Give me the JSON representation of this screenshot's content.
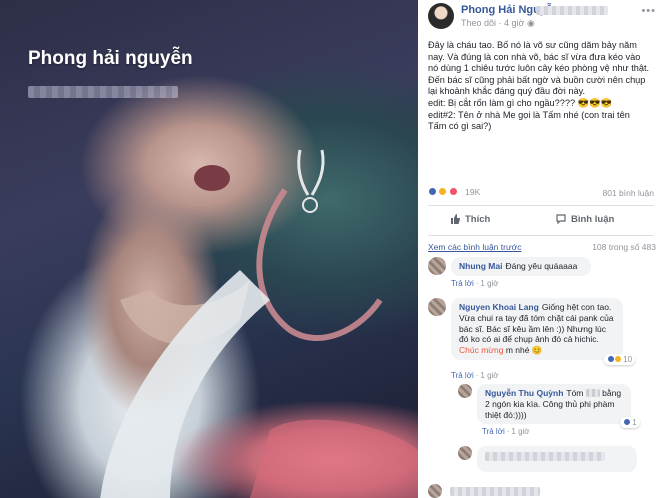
{
  "photo": {
    "watermark_name": "Phong hải nguyễn"
  },
  "post": {
    "author": "Phong Hải Nguyễn",
    "follow_label": "Theo dõi",
    "time": "4 giờ",
    "more_icon": "more-dots-icon",
    "text_lines": [
      "Đây là cháu tao. Bố nó là võ sư cũng dăm bảy năm nay. Và đúng là con nhà võ, bác sĩ vừa đưa kéo vào nó dùng 1 chiêu tước luôn cây kéo phòng vệ như thật. Đến bác sĩ cũng phải bất ngờ và buồn cười nên chụp lại khoảnh khắc đáng quý đầu đời này.",
      "edit: Bị cắt rốn làm gì cho ngầu???? 😎😎😎",
      "edit#2: Tên ở nhà Me gọi là Tấm nhé (con trai tên Tấm có gì sai?)"
    ],
    "reactions_count": "19K",
    "comments_count": "801 bình luận",
    "like_label": "Thích",
    "comment_label": "Bình luận",
    "view_previous": "Xem các bình luận trước",
    "comment_total": "108 trong số 483"
  },
  "comments": [
    {
      "name": "Nhung Mai",
      "text": "Đáng yêu quáaaaa",
      "reply_label": "Trả lời",
      "time": "1 giờ"
    },
    {
      "name": "Nguyen Khoai Lang",
      "text": "Giống hệt con tao. Vừa chui ra tay đã tóm chặt cái pank của bác sĩ. Bác sĩ kêu ầm lên :)) Nhưng lúc đó ko có ai để chụp ảnh đó cả hichic.",
      "highlight": "Chúc mừng",
      "tail": "m nhé 😊",
      "likes": "10",
      "reply_label": "Trả lời",
      "time": "1 giờ"
    },
    {
      "name": "Nguyễn Thu Quỳnh",
      "text_a": "Tóm",
      "text_b": "bằng 2 ngón kia kìa. Công thủ phi phàm thiệt đó:))))",
      "likes": "1",
      "reply_label": "Trả lời",
      "time": "1 giờ"
    }
  ],
  "colors": {
    "link": "#365899",
    "accent": "#4267b2",
    "highlight": "#f5533d"
  }
}
